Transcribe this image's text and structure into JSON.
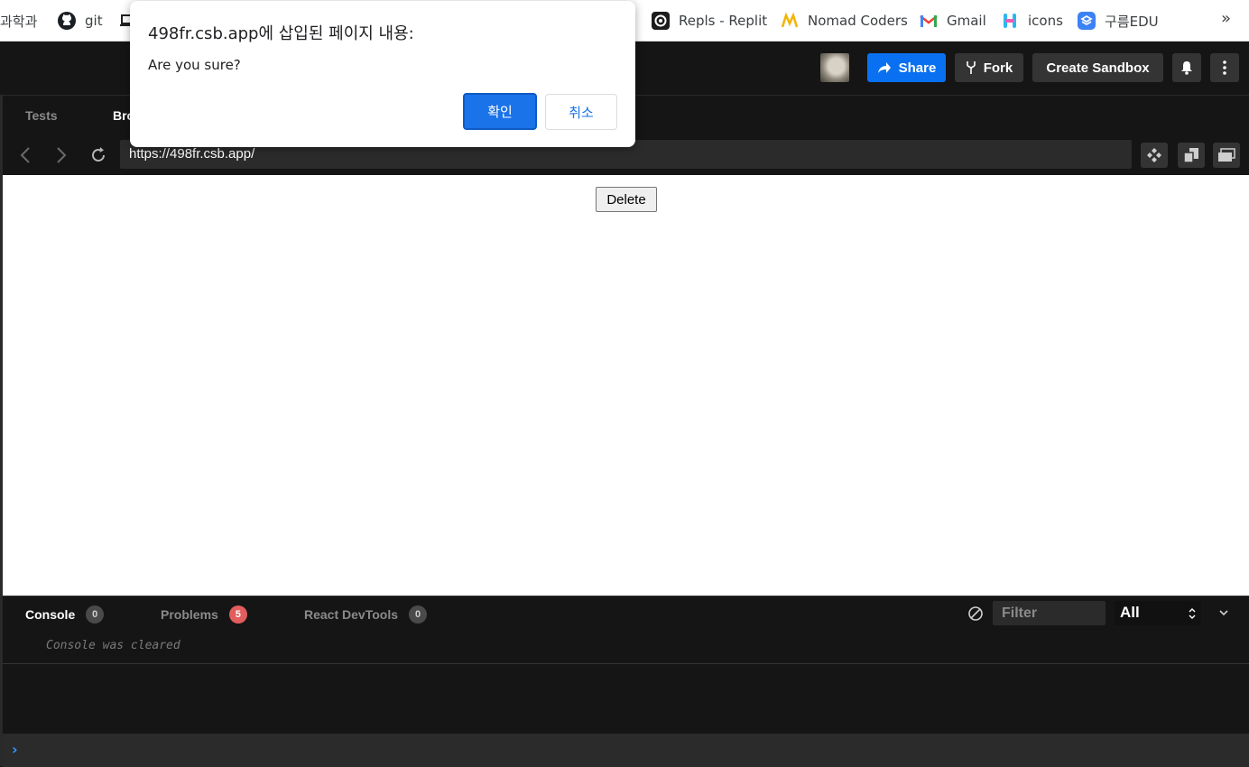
{
  "bookmarks": {
    "items": [
      {
        "label": "과학과",
        "icon": "none"
      },
      {
        "label": "git",
        "icon": "github-icon"
      },
      {
        "label": "Repls - Replit",
        "icon": "replit-icon"
      },
      {
        "label": "Nomad Coders",
        "icon": "nomad-coders-icon"
      },
      {
        "label": "Gmail",
        "icon": "gmail-icon"
      },
      {
        "label": "icons",
        "icon": "icons-icon"
      },
      {
        "label": "구름EDU",
        "icon": "goorm-icon"
      }
    ],
    "more": "»"
  },
  "header": {
    "share_label": "Share",
    "fork_label": "Fork",
    "create_label": "Create Sandbox"
  },
  "preview": {
    "tabs": [
      {
        "label": "Tests"
      },
      {
        "label": "Bro"
      }
    ],
    "url": "https://498fr.csb.app/",
    "delete_label": "Delete"
  },
  "console": {
    "tabs": [
      {
        "label": "Console",
        "count": "0"
      },
      {
        "label": "Problems",
        "count": "5"
      },
      {
        "label": "React DevTools",
        "count": "0"
      }
    ],
    "filter_placeholder": "Filter",
    "level": "All",
    "message": "Console was cleared",
    "prompt": "›"
  },
  "dialog": {
    "title": "498fr.csb.app에 삽입된 페이지 내용:",
    "message": "Are you sure?",
    "ok_label": "확인",
    "cancel_label": "취소"
  },
  "colors": {
    "accent": "#0971f1",
    "dialog_ok": "#1a73e8",
    "problems_badge": "#e25d5d",
    "panel_bg": "#151515"
  }
}
